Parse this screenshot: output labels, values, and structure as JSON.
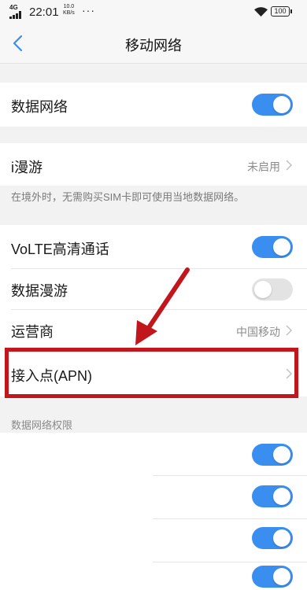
{
  "status_bar": {
    "signal": "4G",
    "time": "22:01",
    "net_speed_value": "10.0",
    "net_speed_unit": "KB/s",
    "dots": "···",
    "battery": "100"
  },
  "nav": {
    "title": "移动网络",
    "back_icon": "chevron-left-icon"
  },
  "settings": {
    "data_network": {
      "label": "数据网络",
      "enabled": true
    },
    "iroaming": {
      "label": "i漫游",
      "value": "未启用"
    },
    "iroaming_note": "在境外时，无需购买SIM卡即可使用当地数据网络。",
    "volte": {
      "label": "VoLTE高清通话",
      "enabled": true
    },
    "data_roaming": {
      "label": "数据漫游",
      "enabled": false
    },
    "carrier": {
      "label": "运营商",
      "value": "中国移动"
    },
    "apn": {
      "label": "接入点(APN)"
    }
  },
  "permissions": {
    "header": "数据网络权限",
    "toggles": [
      true,
      true,
      true,
      true
    ]
  },
  "colors": {
    "toggle_on": "#3a8ef0",
    "toggle_off": "#e3e3e3",
    "highlight": "#c0161c",
    "accent": "#3a8ef0"
  }
}
